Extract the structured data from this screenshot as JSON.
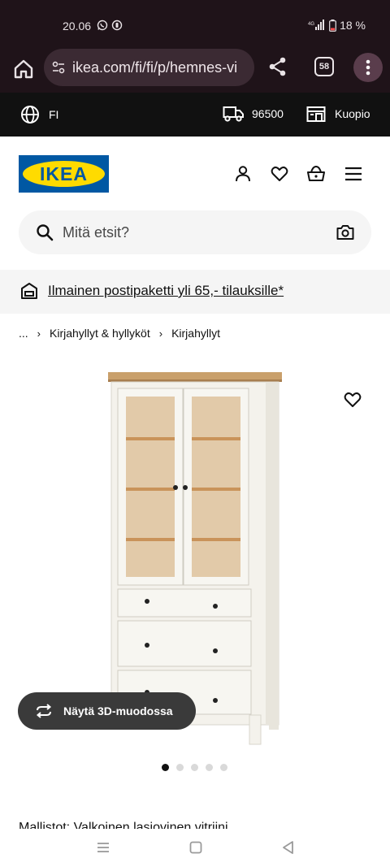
{
  "status_bar": {
    "time": "20.06",
    "battery": "18 %",
    "network": "4G",
    "icons": [
      "whatsapp-icon",
      "notification-icon",
      "signal-icon",
      "battery-icon"
    ]
  },
  "browser": {
    "url": "ikea.com/fi/fi/p/hemnes-vi",
    "tab_count": "58"
  },
  "utility_bar": {
    "language": "FI",
    "postal_code": "96500",
    "store": "Kuopio"
  },
  "header": {
    "logo_text": "IKEA",
    "brand_colors": {
      "blue": "#0058a3",
      "yellow": "#ffdb00"
    }
  },
  "search": {
    "placeholder": "Mitä etsit?"
  },
  "promo": {
    "text": "Ilmainen postipaketti yli 65,- tilauksille*"
  },
  "breadcrumb": {
    "items": [
      "...",
      "Kirjahyllyt & hyllyköt",
      "Kirjahyllyt"
    ]
  },
  "product": {
    "view_3d_label": "Näytä 3D-muodossa",
    "image_count": 5,
    "active_image": 1,
    "partial_text": "Mallistot: Valkoinen lasiovinen vitriini"
  }
}
